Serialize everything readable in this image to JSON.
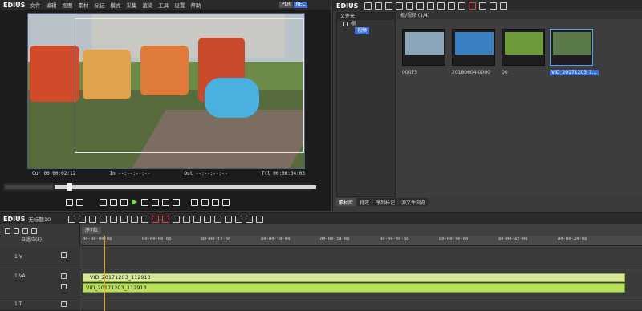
{
  "player": {
    "app_name": "EDIUS",
    "menu": [
      "文件",
      "编辑",
      "视图",
      "素材",
      "标记",
      "模式",
      "采集",
      "渲染",
      "工具",
      "设置",
      "帮助"
    ],
    "plr_label": "PLR",
    "rec_label": "REC",
    "timecodes": {
      "cur": "Cur 00:00:02:12",
      "in": "In --:--:--:--",
      "out": "Out --:--:--:--",
      "ttl": "Ttl 00:00:54:03"
    }
  },
  "bin": {
    "app_name": "EDIUS",
    "folder_header": "文件夹",
    "root_node": "根",
    "selected_folder": "视频",
    "path": "根/视频 (1/4)",
    "clips": [
      {
        "name": "00075"
      },
      {
        "name": "20180604-0000"
      },
      {
        "name": "00"
      },
      {
        "name": "VID_20171203_1..."
      }
    ],
    "tabs": [
      "素材库",
      "特效",
      "序列标记",
      "源文件浏览"
    ],
    "active_tab": "素材库"
  },
  "timeline": {
    "app_name": "EDIUS",
    "project_title": "无标题10",
    "sequence_tab": "序列1",
    "ruler_ticks": [
      "00:00:00:00",
      "00:00:06:00",
      "00:00:12:00",
      "00:00:18:00",
      "00:00:24:00",
      "00:00:30:00",
      "00:00:36:00",
      "00:00:42:00",
      "00:00:48:00"
    ],
    "tracks": [
      {
        "label": "自适应(F)",
        "kind": "header"
      },
      {
        "label": "1 V",
        "kind": "video"
      },
      {
        "label": "1 VA",
        "kind": "video-audio"
      },
      {
        "label": "1 T",
        "kind": "title"
      }
    ],
    "video_clip": "VID_20171203_112913",
    "audio_clip": "VID_20171203_112913"
  }
}
